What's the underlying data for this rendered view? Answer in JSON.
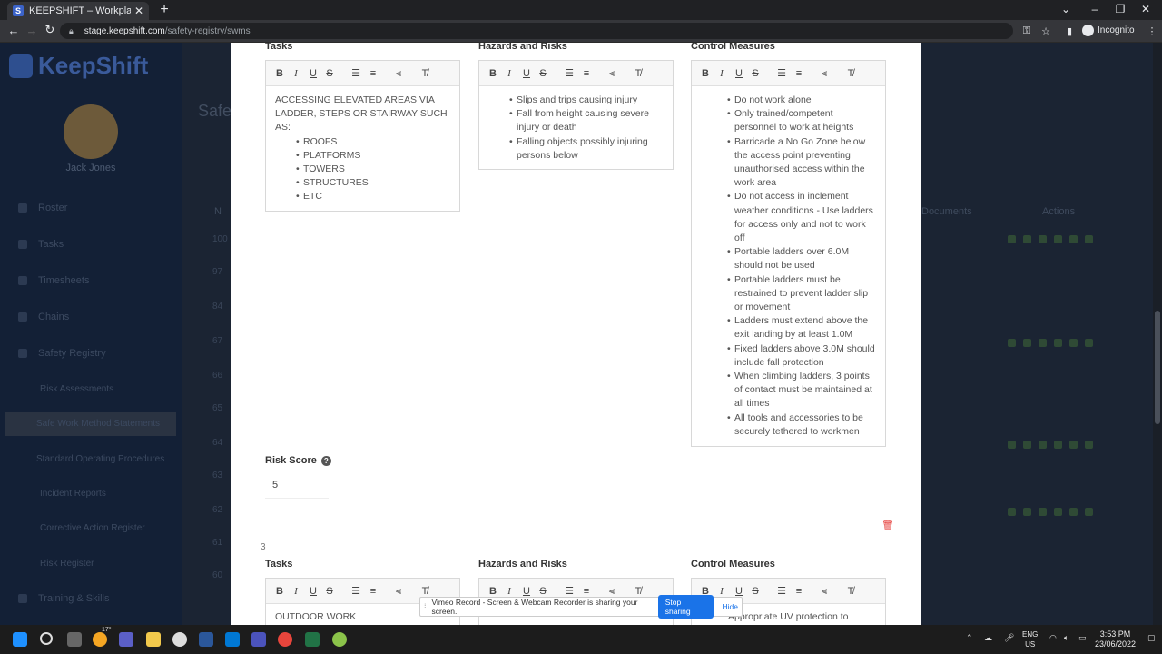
{
  "browser": {
    "tab_title": "KEEPSHIFT – Workplace manage",
    "url_host": "stage.keepshift.com",
    "url_path": "/safety-registry/swms",
    "incognito_label": "Incognito"
  },
  "app": {
    "logo_text": "KeepShift",
    "user_name": "Jack Jones",
    "page_heading": "Safe",
    "nav": [
      {
        "label": "Roster"
      },
      {
        "label": "Tasks"
      },
      {
        "label": "Timesheets"
      },
      {
        "label": "Chains"
      },
      {
        "label": "Safety Registry"
      }
    ],
    "nav_sub": [
      {
        "label": "Risk Assessments"
      },
      {
        "label": "Safe Work Method Statements"
      },
      {
        "label": "Standard Operating Procedures"
      },
      {
        "label": "Incident Reports"
      },
      {
        "label": "Corrective Action Register"
      },
      {
        "label": "Risk Register"
      }
    ],
    "nav_training": "Training & Skills",
    "bg_columns": {
      "n": "N",
      "documents": "Documents",
      "actions": "Actions"
    },
    "bg_numbers": [
      "100",
      "97",
      "84",
      "67",
      "66",
      "65",
      "64",
      "63",
      "62",
      "61",
      "60"
    ]
  },
  "modal": {
    "section1": {
      "tasks_label": "Tasks",
      "hazards_label": "Hazards and Risks",
      "controls_label": "Control Measures",
      "tasks_intro": "ACCESSING ELEVATED AREAS VIA LADDER, STEPS OR STAIRWAY SUCH AS:",
      "tasks_items": [
        "ROOFS",
        "PLATFORMS",
        "TOWERS",
        "STRUCTURES",
        "ETC"
      ],
      "hazards_items": [
        "Slips and trips causing injury",
        "Fall from height causing severe injury or death",
        "Falling objects possibly injuring persons below"
      ],
      "controls_items": [
        "Do not work alone",
        "Only trained/competent personnel to work at heights",
        "Barricade a No Go Zone below the access point preventing unauthorised access within the work area",
        "Do not access in inclement weather conditions - Use ladders for access only and not to work off",
        "Portable ladders over 6.0M should not be used",
        "Portable ladders must be restrained to prevent ladder slip or movement",
        "Ladders must extend above the exit landing by at least 1.0M",
        "Fixed ladders above 3.0M should include fall protection",
        "When climbing ladders, 3 points of contact must be maintained at all times",
        "All tools and accessories to be securely tethered to workmen"
      ],
      "risk_score_label": "Risk Score",
      "risk_score_value": "5"
    },
    "section2": {
      "row_number": "3",
      "tasks_label": "Tasks",
      "hazards_label": "Hazards and Risks",
      "controls_label": "Control Measures",
      "tasks_first_line": "OUTDOOR WORK",
      "controls_first_line": "Appropriate UV protection to"
    },
    "toolbar_icons": [
      "bold-icon",
      "italic-icon",
      "underline-icon",
      "strikethrough-icon",
      "ordered-list-icon",
      "bullet-list-icon",
      "align-icon",
      "clear-format-icon"
    ]
  },
  "share_banner": {
    "message": "Vimeo Record - Screen & Webcam Recorder is sharing your screen.",
    "stop_label": "Stop sharing",
    "hide_label": "Hide"
  },
  "taskbar": {
    "lang_top": "ENG",
    "lang_bottom": "US",
    "time": "3:53 PM",
    "date": "23/06/2022",
    "weather": "17°"
  },
  "colors": {
    "accent": "#1a73e8",
    "delete": "#e53935",
    "backdrop": "#1b2433"
  }
}
